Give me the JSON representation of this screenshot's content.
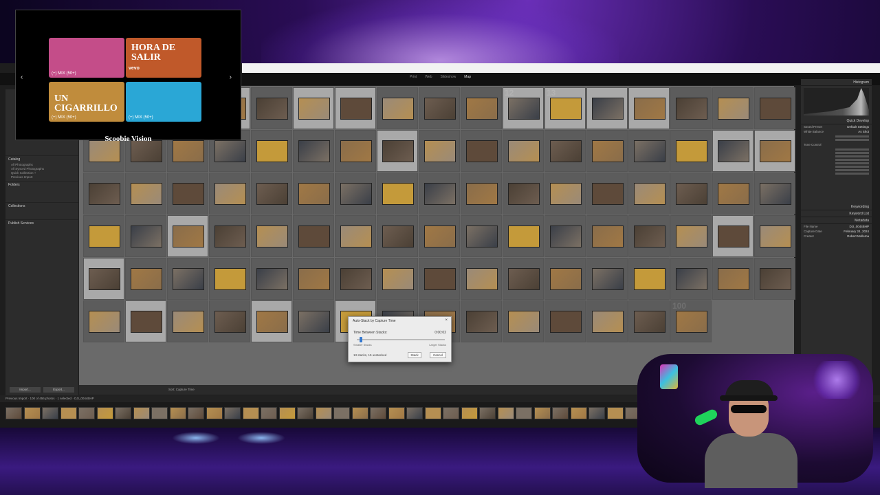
{
  "lightroom": {
    "modules": [
      "Print",
      "Web",
      "Slideshow",
      "Map"
    ],
    "left_panel": {
      "catalog_header": "Catalog",
      "catalog_items": [
        "All Photographs",
        "All Synced Photographs",
        "Quick Collection +",
        "Previous Import"
      ],
      "folders_header": "Folders",
      "collections_header": "Collections",
      "publish_header": "Publish Services",
      "import_button": "Import...",
      "export_button": "Export..."
    },
    "grid_numbers": [
      "",
      "",
      "",
      "",
      "",
      "",
      "",
      "",
      "",
      "",
      "12",
      "13",
      "",
      "",
      "",
      "",
      "",
      "",
      "",
      "",
      "",
      "",
      "",
      "",
      "",
      "",
      "",
      "",
      "",
      "",
      "",
      "",
      "",
      "",
      "",
      "",
      "",
      "",
      "",
      "",
      "",
      "",
      "",
      "",
      "",
      "",
      "",
      "",
      "",
      "",
      "",
      "",
      "",
      "",
      "",
      "",
      "",
      "",
      "",
      "",
      "",
      "",
      "",
      "",
      "",
      "",
      "",
      "",
      "",
      "",
      "",
      "",
      "",
      "",
      "",
      "",
      "",
      "",
      "",
      "",
      "",
      "",
      "",
      "",
      "",
      "",
      "",
      "",
      "",
      "",
      "",
      "",
      "",
      "",
      "",
      "",
      "",
      "",
      "",
      "100"
    ],
    "toolbar": {
      "sort_label": "Sort:",
      "sort_value": "Capture Time"
    },
    "right_panel": {
      "histogram_label": "Histogram",
      "quick_develop_label": "Quick Develop",
      "saved_preset_label": "Saved Preset",
      "saved_preset_value": "Default Settings",
      "white_balance_label": "White Balance",
      "white_balance_value": "As Shot",
      "tone_control_label": "Tone Control",
      "keywording_label": "Keywording",
      "keyword_list_label": "Keyword List",
      "metadata_label": "Metadata",
      "file_name_label": "File Name",
      "file_name_value": "DJI_0044BHP",
      "capture_date_label": "Capture Date",
      "capture_date_value": "February 24, 2024",
      "creator_label": "Creator",
      "creator_value": "Robert Mollema"
    },
    "filmstrip": {
      "source": "Previous Import",
      "count": "100 of 456 photos",
      "selected": "1 selected",
      "filename": "DJI_0044BHP"
    }
  },
  "dialog": {
    "title": "Auto-Stack by Capture Time",
    "close": "×",
    "field_label": "Time Between Stacks:",
    "field_value": "0:00:02",
    "min_label": "Smaller Stacks",
    "max_label": "Larger Stacks",
    "slider_fraction": 0.05,
    "summary": "13 stacks, 15 unstacked",
    "stack_button": "Stack",
    "cancel_button": "Cancel"
  },
  "music_overlay": {
    "tiles": [
      {
        "title": "",
        "mix": "(+) MIX (50+)",
        "bg": "#c44d89"
      },
      {
        "title": "HORA DE SALIR",
        "mix": "",
        "vevo": "vevo",
        "bg": "#c0592a"
      },
      {
        "title": "UN CIGARRILLO",
        "mix": "(+) MIX (50+)",
        "bg": "#c08c3c"
      },
      {
        "title": "",
        "mix": "(+) MIX (50+)",
        "bg": "#2aa7d6"
      }
    ],
    "prev_arrow": "‹",
    "next_arrow": "›",
    "label": "Scoobie Vision"
  }
}
